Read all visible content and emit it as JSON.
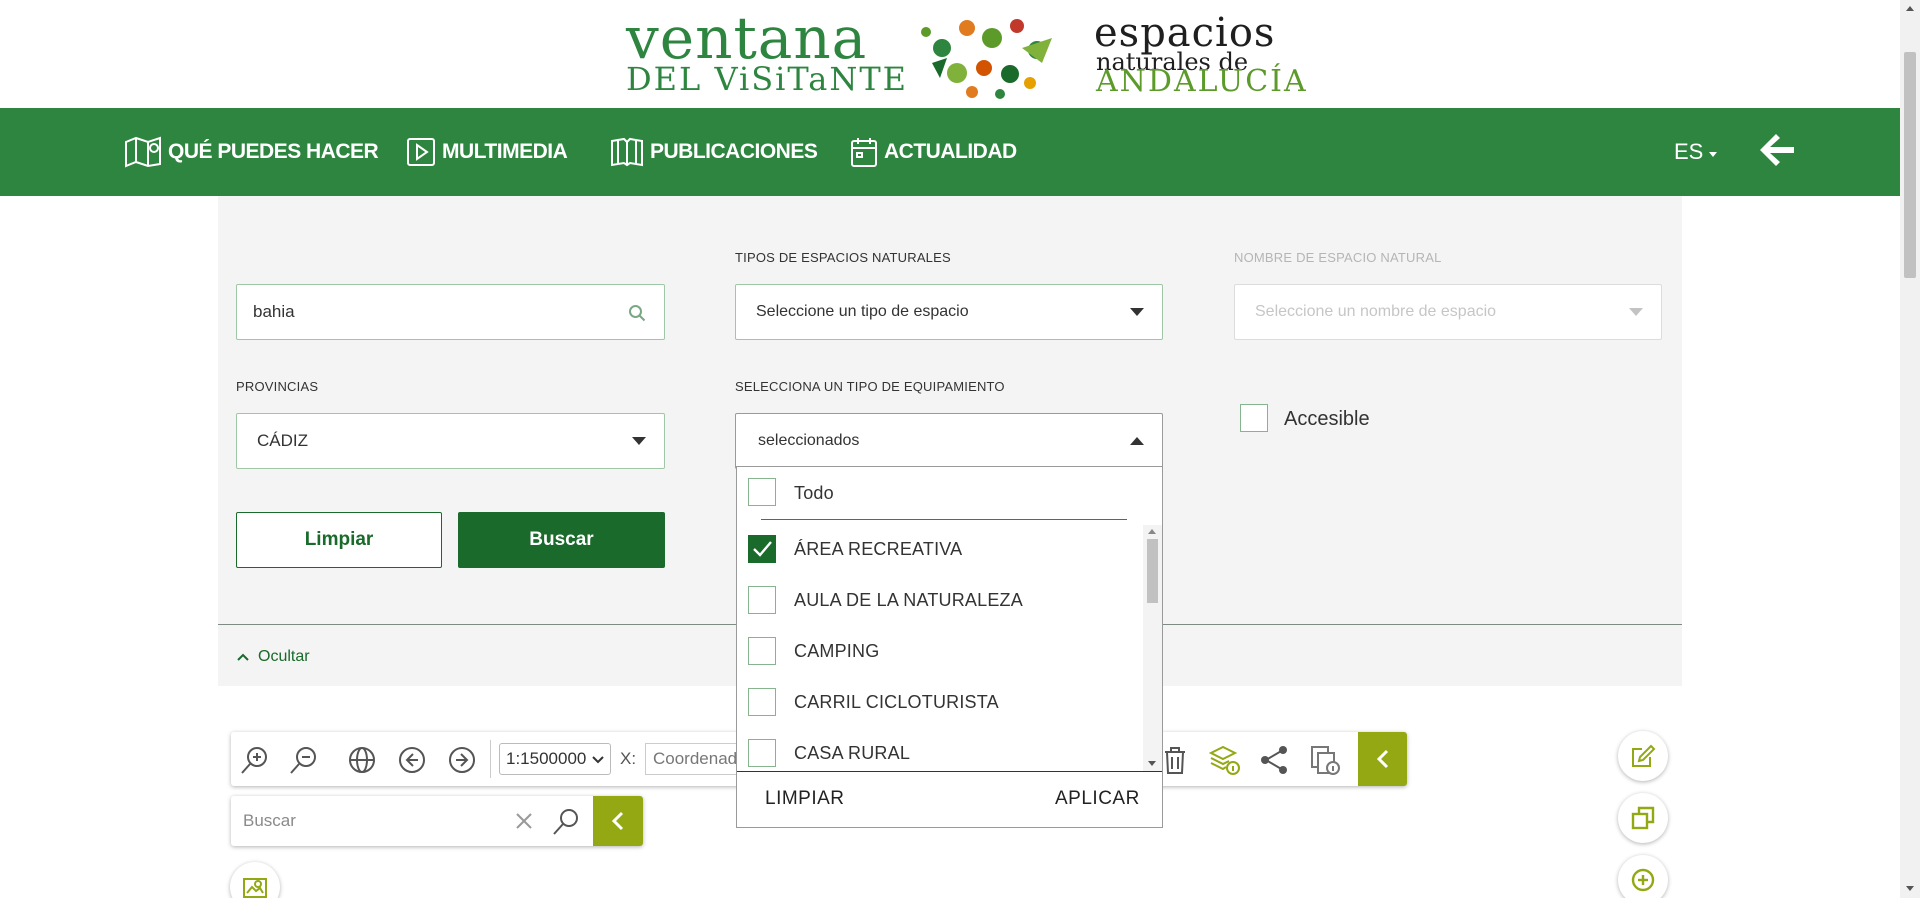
{
  "logo": {
    "line1": "ventana",
    "line2": "DEL ViSiTaNTE",
    "line3": "espacios",
    "line4": "naturales de",
    "line5": "ANDALUCÍA"
  },
  "nav": {
    "items": [
      {
        "label": "QUÉ PUEDES HACER",
        "icon": "map-pin-icon"
      },
      {
        "label": "MULTIMEDIA",
        "icon": "play-icon"
      },
      {
        "label": "PUBLICACIONES",
        "icon": "book-icon"
      },
      {
        "label": "ACTUALIDAD",
        "icon": "calendar-icon"
      }
    ],
    "language": "ES",
    "back_icon": "arrow-left-icon"
  },
  "filters": {
    "search_value": "bahia",
    "tipos_label": "TIPOS DE ESPACIOS NATURALES",
    "tipos_placeholder": "Seleccione un tipo de espacio",
    "nombre_label": "NOMBRE DE ESPACIO NATURAL",
    "nombre_placeholder": "Seleccione un nombre de espacio",
    "provincias_label": "PROVINCIAS",
    "provincia_value": "CÁDIZ",
    "equipamiento_label": "SELECCIONA UN TIPO DE EQUIPAMIENTO",
    "equipamiento_value": "seleccionados",
    "accesible_label": "Accesible",
    "clear_label": "Limpiar",
    "search_label": "Buscar",
    "hide_label": "Ocultar"
  },
  "dropdown": {
    "all_label": "Todo",
    "options": [
      {
        "label": "ÁREA RECREATIVA",
        "checked": true
      },
      {
        "label": "AULA DE LA NATURALEZA",
        "checked": false
      },
      {
        "label": "CAMPING",
        "checked": false
      },
      {
        "label": "CARRIL CICLOTURISTA",
        "checked": false
      },
      {
        "label": "CASA RURAL",
        "checked": false
      }
    ],
    "clear_label": "LIMPIAR",
    "apply_label": "APLICAR"
  },
  "map": {
    "scale": "1:1500000",
    "x_label": "X:",
    "coord_placeholder": "Coordenada",
    "search_placeholder": "Buscar"
  },
  "colors": {
    "brand_green": "#2e8540",
    "dark_green": "#196a2b",
    "map_accent": "#94a813"
  }
}
